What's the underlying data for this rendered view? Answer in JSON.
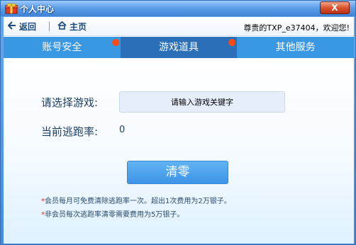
{
  "window": {
    "title": "个人中心",
    "close_label": "X"
  },
  "nav": {
    "back_label": "返回",
    "home_label": "主页",
    "greeting": "尊贵的TXP_e37404，欢迎您!"
  },
  "tabs": [
    {
      "label": "账号安全",
      "active": false,
      "has_dot": true
    },
    {
      "label": "游戏道具",
      "active": true,
      "has_dot": true
    },
    {
      "label": "其他服务",
      "active": false,
      "has_dot": false
    }
  ],
  "form": {
    "game_label": "请选择游戏:",
    "search_placeholder": "请输入游戏关键字",
    "rate_label": "当前逃跑率:",
    "rate_value": "0",
    "clear_label": "清零"
  },
  "notes": [
    {
      "star": "*",
      "text": "会员每月可免费清除逃跑率一次。超出1次费用为2万银子。"
    },
    {
      "star": "*",
      "text": "非会员每次逃跑率清零需要费用为5万银子。"
    }
  ],
  "colors": {
    "tab_bg": "#3a97e1",
    "tab_active": "#2a6fb7",
    "dot": "#ff4a16",
    "button": "#3d95e6",
    "note_star": "#e0301e"
  }
}
